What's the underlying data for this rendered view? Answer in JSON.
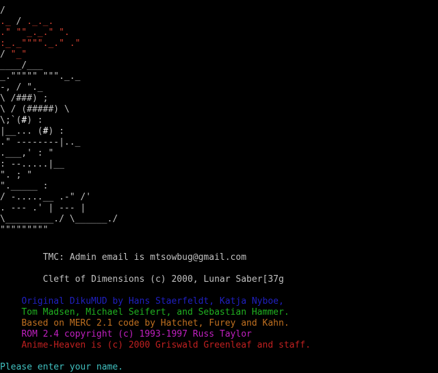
{
  "colors": {
    "background": "#000000",
    "text_gray": "#c0c0c0",
    "bow_red": "#d04030",
    "eye_white": "#ffffff",
    "blue": "#2020c0",
    "green": "#20b020",
    "orange": "#c07020",
    "magenta": "#c020c0",
    "dark_red": "#c02020",
    "prompt_cyan": "#40c0c0"
  },
  "art": {
    "lines": [
      {
        "segs": [
          {
            "t": "                                       /",
            "c": "gray"
          }
        ]
      },
      {
        "segs": [
          {
            "t": "                           ._   ",
            "c": "red"
          },
          {
            "t": "/",
            "c": "gray"
          },
          {
            "t": "  ._._.",
            "c": "red"
          }
        ]
      },
      {
        "segs": [
          {
            "t": "                          .\"  \"\"_._.\"   \".",
            "c": "red"
          }
        ]
      },
      {
        "segs": [
          {
            "t": "                          :_._\"\"\"\"._.\"  .\"",
            "c": "red"
          }
        ]
      },
      {
        "segs": [
          {
            "t": "                               ",
            "c": "gray"
          },
          {
            "t": "/",
            "c": "gray"
          },
          {
            "t": "          \"_\"",
            "c": "red"
          }
        ]
      },
      {
        "segs": [
          {
            "t": "                           ____/___",
            "c": "gray"
          }
        ]
      },
      {
        "segs": [
          {
            "t": "                    _.\"\"\"\"\"      \"\"\"._._",
            "c": "gray"
          }
        ]
      },
      {
        "segs": [
          {
            "t": "             -,     /                   \"._",
            "c": "gray"
          }
        ]
      },
      {
        "segs": [
          {
            "t": "               \\   /###)                   ;",
            "c": "gray"
          }
        ]
      },
      {
        "segs": [
          {
            "t": "                \\ /          (#####)       \\",
            "c": "gray"
          }
        ]
      },
      {
        "segs": [
          {
            "t": "                 \\;`(",
            "c": "gray"
          },
          {
            "t": "#",
            "c": "white"
          },
          {
            "t": ")                        :",
            "c": "gray"
          }
        ]
      },
      {
        "segs": [
          {
            "t": "                  |__...       (",
            "c": "gray"
          },
          {
            "t": "#",
            "c": "white"
          },
          {
            "t": ")           :",
            "c": "gray"
          }
        ]
      },
      {
        "segs": [
          {
            "t": "                 .\"                 --------|.._",
            "c": "gray"
          }
        ]
      },
      {
        "segs": [
          {
            "t": "           .___,'                           :   \"",
            "c": "gray"
          }
        ]
      },
      {
        "segs": [
          {
            "t": "               :                    --.....|__",
            "c": "gray"
          }
        ]
      },
      {
        "segs": [
          {
            "t": "               \".                            ;  \"",
            "c": "gray"
          }
        ]
      },
      {
        "segs": [
          {
            "t": "                 \"._____                    :",
            "c": "gray"
          }
        ]
      },
      {
        "segs": [
          {
            "t": "                   /        -.....__ .-\"    /'",
            "c": "gray"
          }
        ]
      },
      {
        "segs": [
          {
            "t": "                  . ---        .'  |   ---  |",
            "c": "gray"
          }
        ]
      },
      {
        "segs": [
          {
            "t": "                  \\_________./    \\______./",
            "c": "gray"
          }
        ]
      },
      {
        "segs": [
          {
            "t": "                                   \"\"\"\"\"\"\"\"\"",
            "c": "gray"
          }
        ]
      }
    ]
  },
  "info": {
    "admin_line": "TMC: Admin email is mtsowbug@gmail.com",
    "title_line": "Cleft of Dimensions (c) 2000, Lunar Saber[37g"
  },
  "credits": [
    {
      "text": "Original DikuMUD by Hans Staerfeldt, Katja Nyboe,",
      "color": "#2020c0"
    },
    {
      "text": "Tom Madsen, Michael Seifert, and Sebastian Hammer.",
      "color": "#20b020"
    },
    {
      "text": "Based on MERC 2.1 code by Hatchet, Furey and Kahn.",
      "color": "#c07020"
    },
    {
      "text": "ROM 2.4 copyright (c) 1993-1997 Russ Taylor",
      "color": "#c020c0"
    },
    {
      "text": "Anime-Heaven is (c) 2000 Griswald Greenleaf and staff.",
      "color": "#c02020"
    }
  ],
  "prompt": {
    "text": "Please enter your name."
  }
}
